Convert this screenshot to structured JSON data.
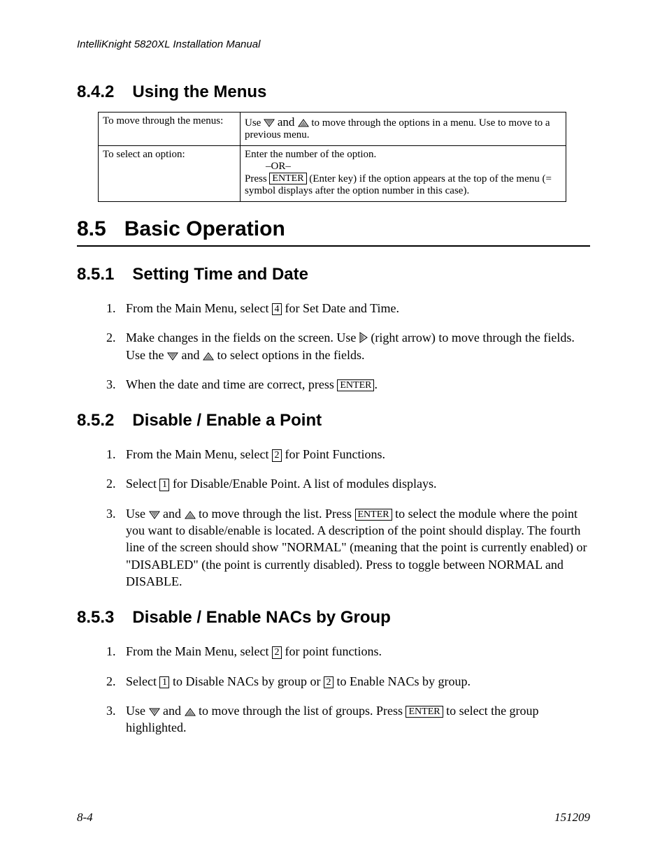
{
  "header": {
    "running": "IntelliKnight 5820XL Installation Manual"
  },
  "s842": {
    "no": "8.4.2",
    "title": "Using the Menus"
  },
  "table": {
    "r1": {
      "l": "To move through the menus:",
      "r_a": "Use ",
      "r_b": " and ",
      "r_c": " to move through the options in a menu. Use  to move to a previous menu."
    },
    "r2": {
      "l": "To select an option:",
      "line1": "Enter the number of the option.",
      "or": "–OR–",
      "press": "Press ",
      "enter": "ENTER",
      "after": " (Enter key) if the option appears at the top of the menu (= symbol displays after the option number in this case)."
    }
  },
  "s85": {
    "no": "8.5",
    "title": "Basic Operation"
  },
  "s851": {
    "no": "8.5.1",
    "title": "Setting Time and Date"
  },
  "steps851": {
    "i1a": "From the Main Menu, select ",
    "i1key": "4",
    "i1b": " for Set Date and Time.",
    "i2a": "Make changes in the fields on the screen. Use ",
    "i2b": " (right arrow) to move through the fields. Use the ",
    "i2c": " and ",
    "i2d": " to select options in the fields.",
    "i3a": "When the date and time are correct, press ",
    "i3key": "ENTER",
    "i3b": "."
  },
  "s852": {
    "no": "8.5.2",
    "title": "Disable / Enable a Point"
  },
  "steps852": {
    "i1a": "From the Main Menu, select ",
    "i1key": "2",
    "i1b": " for Point Functions.",
    "i2a": "Select ",
    "i2key": "1",
    "i2b": " for Disable/Enable Point. A list of modules displays.",
    "i3a": "Use ",
    "i3b": " and ",
    "i3c": " to move through the list. Press ",
    "i3key": "ENTER",
    "i3d": " to select the module where the point you want to disable/enable is located. A description of the point should display. The fourth line of the screen should show \"NORMAL\" (meaning that the point is currently enabled) or \"DISABLED\" (the point is currently disabled). Press  to toggle between NORMAL and DISABLE."
  },
  "s853": {
    "no": "8.5.3",
    "title": "Disable / Enable NACs by Group"
  },
  "steps853": {
    "i1a": "From the Main Menu, select ",
    "i1key": "2",
    "i1b": " for point functions.",
    "i2a": "Select ",
    "i2key1": "1",
    "i2b": " to Disable NACs by group or ",
    "i2key2": "2",
    "i2c": " to Enable NACs by group.",
    "i3a": "Use ",
    "i3b": " and ",
    "i3c": " to move through the list of groups. Press ",
    "i3key": "ENTER",
    "i3d": " to select the group highlighted."
  },
  "footer": {
    "left": "8-4",
    "right": "151209"
  }
}
